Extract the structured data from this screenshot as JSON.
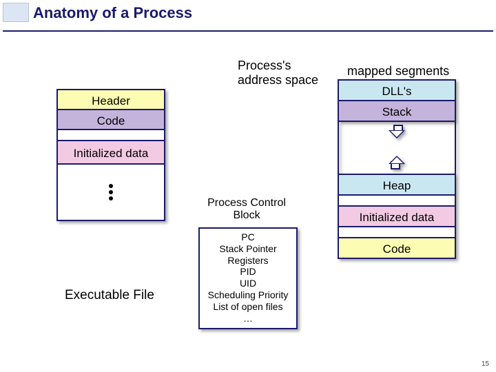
{
  "slide": {
    "title": "Anatomy of a Process",
    "page_number": "15"
  },
  "labels": {
    "process_addr_line1": "Process's",
    "process_addr_line2": "address space",
    "mapped_segments": "mapped segments",
    "pcb_title_line1": "Process Control",
    "pcb_title_line2": "Block",
    "executable_file": "Executable File"
  },
  "executable": {
    "header": "Header",
    "code": "Code",
    "init_data": "Initialized data"
  },
  "address_space": {
    "dlls": "DLL's",
    "stack": "Stack",
    "heap": "Heap",
    "init_data": "Initialized data",
    "code": "Code"
  },
  "pcb": {
    "items": [
      "PC",
      "Stack Pointer",
      "Registers",
      "PID",
      "UID",
      "Scheduling Priority",
      "List of open files",
      "…"
    ]
  }
}
